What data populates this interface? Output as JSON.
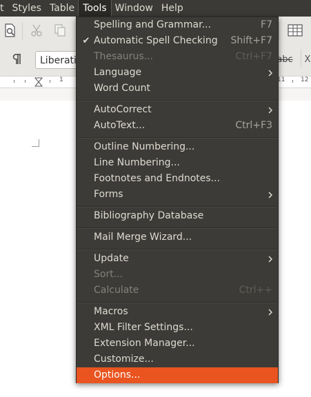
{
  "menubar": {
    "items": [
      "t",
      "Styles",
      "Table",
      "Tools",
      "Window",
      "Help"
    ],
    "active": "Tools"
  },
  "toolbar": {
    "font_name": "Liberati",
    "strikethrough_label": "abc",
    "row2_last": "X"
  },
  "ruler": {
    "numbers": [
      "1",
      "1",
      "11",
      "12"
    ]
  },
  "tools_menu": {
    "items": [
      {
        "label": "Spelling and Grammar...",
        "accel": "F7"
      },
      {
        "label": "Automatic Spell Checking",
        "accel": "Shift+F7",
        "check": "✔"
      },
      {
        "label": "Thesaurus...",
        "accel": "Ctrl+F7",
        "disabled": true
      },
      {
        "label": "Language",
        "submenu": true
      },
      {
        "label": "Word Count"
      },
      {
        "label": "AutoCorrect",
        "submenu": true
      },
      {
        "label": "AutoText...",
        "accel": "Ctrl+F3"
      },
      {
        "label": "Outline Numbering..."
      },
      {
        "label": "Line Numbering..."
      },
      {
        "label": "Footnotes and Endnotes..."
      },
      {
        "label": "Forms",
        "submenu": true
      },
      {
        "label": "Bibliography Database"
      },
      {
        "label": "Mail Merge Wizard..."
      },
      {
        "label": "Update",
        "submenu": true
      },
      {
        "label": "Sort...",
        "disabled": true
      },
      {
        "label": "Calculate",
        "accel": "Ctrl++",
        "disabled": true
      },
      {
        "label": "Macros",
        "submenu": true
      },
      {
        "label": "XML Filter Settings..."
      },
      {
        "label": "Extension Manager..."
      },
      {
        "label": "Customize..."
      },
      {
        "label": "Options...",
        "highlighted": true
      }
    ]
  },
  "colors": {
    "menu_bg": "#3c3b37",
    "menu_text": "#dfdbd2",
    "highlight": "#e95420",
    "disabled_text": "#84827c"
  }
}
